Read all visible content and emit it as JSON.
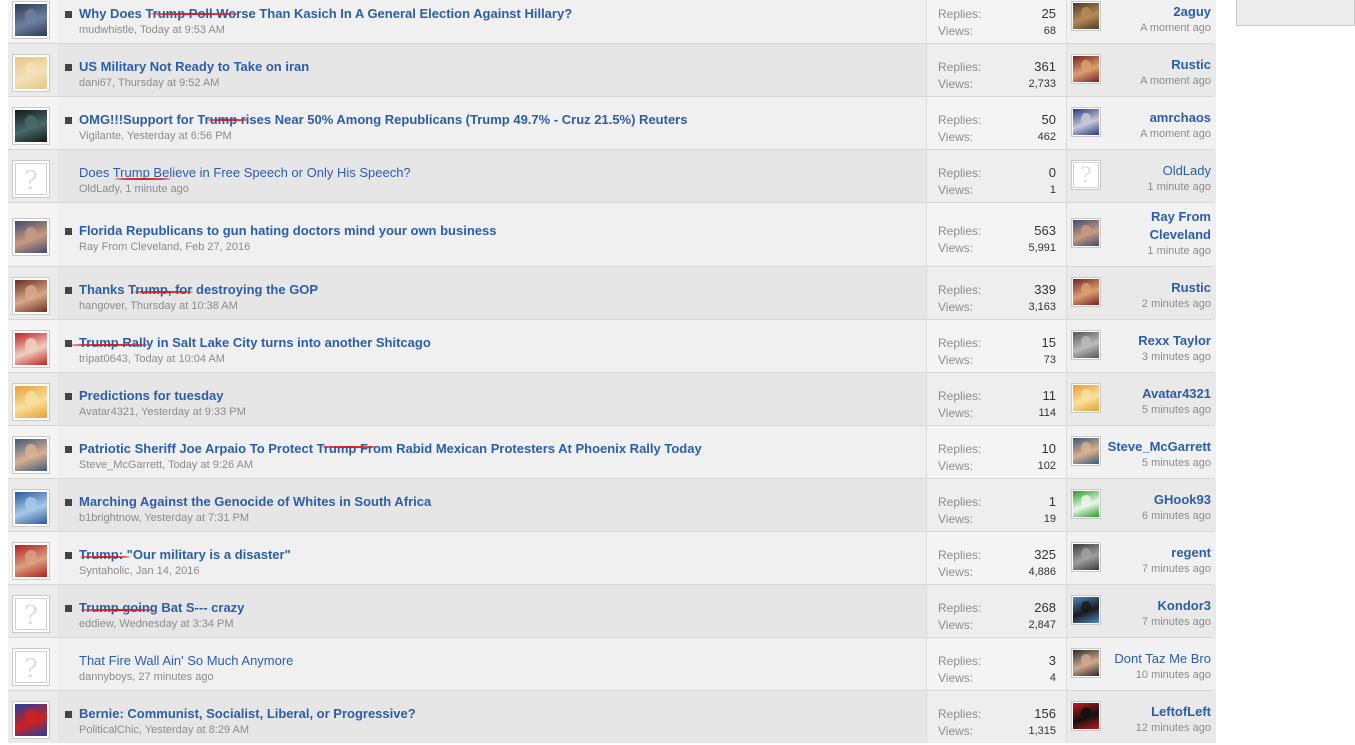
{
  "labels": {
    "replies": "Replies:",
    "views": "Views:"
  },
  "threads": [
    {
      "title": "Why Does Trump Poll Worse Than Kasich In A General Election Against Hillary?",
      "author": "mudwhistle",
      "date": "Today at 9:53 AM",
      "replies": "25",
      "views": "68",
      "last_poster": "2aguy",
      "last_time": "A moment ago",
      "bold": true,
      "avatar_icon": "user-photo-icon",
      "avatar_colors": [
        "#2e3a55",
        "#6f7fa0"
      ],
      "last_avatar_icon": "user-photo-icon",
      "last_colors": [
        "#4a3a2a",
        "#b88a55"
      ]
    },
    {
      "title": "US Military Not Ready to Take on iran",
      "author": "dani67",
      "date": "Thursday at 9:52 AM",
      "replies": "361",
      "views": "2,733",
      "last_poster": "Rustic",
      "last_time": "A moment ago",
      "bold": true,
      "avatar_icon": "child-photo-icon",
      "avatar_colors": [
        "#e8c48a",
        "#f5e0b8"
      ],
      "last_avatar_icon": "suit-photo-icon",
      "last_colors": [
        "#7a2020",
        "#d8a070"
      ]
    },
    {
      "title": "OMG!!!Support for Trump rises Near 50% Among Republicans (Trump 49.7% - Cruz 21.5%) Reuters",
      "author": "Vigilante",
      "date": "Yesterday at 6:56 PM",
      "replies": "50",
      "views": "462",
      "last_poster": "amrchaos",
      "last_time": "A moment ago",
      "bold": true,
      "avatar_icon": "silhouette-icon",
      "avatar_colors": [
        "#10181a",
        "#4a6a6a"
      ],
      "last_avatar_icon": "portrait-icon",
      "last_colors": [
        "#2a3a7a",
        "#c8c8d8"
      ]
    },
    {
      "title": "Does Trump Believe in Free Speech or Only His Speech?",
      "author": "OldLady",
      "date": "1 minute ago",
      "replies": "0",
      "views": "1",
      "last_poster": "OldLady",
      "last_time": "1 minute ago",
      "bold": false,
      "avatar_icon": "default-avatar-icon",
      "avatar_colors": [],
      "last_avatar_icon": "default-avatar-icon",
      "last_colors": []
    },
    {
      "title": "Florida Republicans to gun hating doctors mind your own business",
      "author": "Ray From Cleveland",
      "date": "Feb 27, 2016",
      "replies": "563",
      "views": "5,991",
      "last_poster": "Ray From Cleveland",
      "last_time": "1 minute ago",
      "bold": true,
      "avatar_icon": "man-photo-icon",
      "avatar_colors": [
        "#404a70",
        "#c89a80"
      ],
      "last_avatar_icon": "man-photo-icon",
      "last_colors": [
        "#404a70",
        "#c89a80"
      ]
    },
    {
      "title": "Thanks Trump, for destroying the GOP",
      "author": "hangover",
      "date": "Thursday at 10:38 AM",
      "replies": "339",
      "views": "3,163",
      "last_poster": "Rustic",
      "last_time": "2 minutes ago",
      "bold": true,
      "avatar_icon": "woman-photo-icon",
      "avatar_colors": [
        "#6a3020",
        "#d8a888"
      ],
      "last_avatar_icon": "suit-photo-icon",
      "last_colors": [
        "#7a2020",
        "#d8a070"
      ]
    },
    {
      "title": "Trump Rally in Salt Lake City turns into another Shitcago",
      "author": "tripat0643",
      "date": "Today at 10:04 AM",
      "replies": "15",
      "views": "73",
      "last_poster": "Rexx Taylor",
      "last_time": "3 minutes ago",
      "bold": true,
      "avatar_icon": "baby-photo-icon",
      "avatar_colors": [
        "#c02020",
        "#f0d0c0"
      ],
      "last_avatar_icon": "animal-photo-icon",
      "last_colors": [
        "#555555",
        "#bbbbbb"
      ]
    },
    {
      "title": "Predictions for tuesday",
      "author": "Avatar4321",
      "date": "Yesterday at 9:33 PM",
      "replies": "11",
      "views": "114",
      "last_poster": "Avatar4321",
      "last_time": "5 minutes ago",
      "bold": true,
      "avatar_icon": "cartoon-icon",
      "avatar_colors": [
        "#e8a030",
        "#f8e0a0"
      ],
      "last_avatar_icon": "cartoon-icon",
      "last_colors": [
        "#e8a030",
        "#f8e0a0"
      ]
    },
    {
      "title": "Patriotic Sheriff Joe Arpaio To Protect Trump From Rabid Mexican Protesters At Phoenix Rally Today",
      "author": "Steve_McGarrett",
      "date": "Today at 9:26 AM",
      "replies": "10",
      "views": "102",
      "last_poster": "Steve_McGarrett",
      "last_time": "5 minutes ago",
      "bold": true,
      "avatar_icon": "couple-photo-icon",
      "avatar_colors": [
        "#3a5a7a",
        "#d8b090"
      ],
      "last_avatar_icon": "couple-photo-icon",
      "last_colors": [
        "#3a5a7a",
        "#d8b090"
      ]
    },
    {
      "title": "Marching Against the Genocide of Whites in South Africa",
      "author": "b1brightnow",
      "date": "Yesterday at 7:31 PM",
      "replies": "1",
      "views": "19",
      "last_poster": "GHook93",
      "last_time": "6 minutes ago",
      "bold": true,
      "avatar_icon": "jet-photo-icon",
      "avatar_colors": [
        "#2a5a9a",
        "#a8c8e8"
      ],
      "last_avatar_icon": "frog-cartoon-icon",
      "last_colors": [
        "#2a9a2a",
        "#e8f8e8"
      ]
    },
    {
      "title": "Trump: \"Our military is a disaster\"",
      "author": "Syntaholic",
      "date": "Jan 14, 2016",
      "replies": "325",
      "views": "4,886",
      "last_poster": "regent",
      "last_time": "7 minutes ago",
      "bold": true,
      "avatar_icon": "man-cap-photo-icon",
      "avatar_colors": [
        "#b02020",
        "#d8a080"
      ],
      "last_avatar_icon": "bw-photo-icon",
      "last_colors": [
        "#3a3a3a",
        "#a0a0a0"
      ]
    },
    {
      "title": "Trump going Bat S--- crazy",
      "author": "eddiew",
      "date": "Wednesday at 3:34 PM",
      "replies": "268",
      "views": "2,847",
      "last_poster": "Kondor3",
      "last_time": "7 minutes ago",
      "bold": true,
      "avatar_icon": "default-avatar-icon",
      "avatar_colors": [],
      "last_avatar_icon": "eagle-photo-icon",
      "last_colors": [
        "#4a8ac8",
        "#1a1a1a"
      ]
    },
    {
      "title": "That Fire Wall Ain' So Much Anymore",
      "author": "dannyboys",
      "date": "27 minutes ago",
      "replies": "3",
      "views": "4",
      "last_poster": "Dont Taz Me Bro",
      "last_time": "10 minutes ago",
      "bold": false,
      "avatar_icon": "default-avatar-icon",
      "avatar_colors": [],
      "last_avatar_icon": "man-photo-icon",
      "last_colors": [
        "#2a2a2a",
        "#d0a890"
      ]
    },
    {
      "title": "Bernie: Communist, Socialist, Liberal, or Progressive?",
      "author": "PoliticalChic",
      "date": "Yesterday at 8:29 AM",
      "replies": "156",
      "views": "1,315",
      "last_poster": "LeftofLeft",
      "last_time": "12 minutes ago",
      "bold": true,
      "avatar_icon": "superhero-icon",
      "avatar_colors": [
        "#2040a0",
        "#d02020"
      ],
      "last_avatar_icon": "che-poster-icon",
      "last_colors": [
        "#c81818",
        "#111111"
      ]
    }
  ]
}
